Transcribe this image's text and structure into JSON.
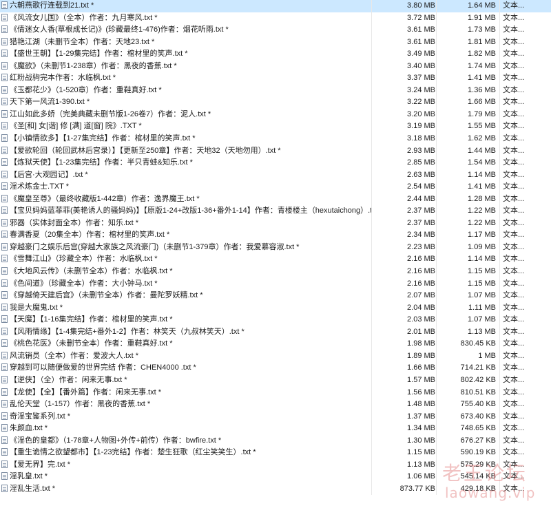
{
  "colors": {
    "selected_row": "#cce8ff",
    "watermark": "#e07878"
  },
  "icon": "text-file-icon",
  "rows": [
    {
      "name": "六朝燕歌行连载到21.txt *",
      "size": "3.80 MB",
      "compressed": "1.64 MB",
      "type": "文本...",
      "selected": true
    },
    {
      "name": "《风流女儿国》（全本）作者：九月寒风.txt *",
      "size": "3.72 MB",
      "compressed": "1.91 MB",
      "type": "文本..."
    },
    {
      "name": "《倩迷女人香(草根成长记)》(珍藏最终1-476)作者：烟花听雨.txt *",
      "size": "3.61 MB",
      "compressed": "1.73 MB",
      "type": "文本..."
    },
    {
      "name": "猎艳江湖（未删节全本）作者：天地23.txt *",
      "size": "3.61 MB",
      "compressed": "1.81 MB",
      "type": "文本..."
    },
    {
      "name": "【盛世王朝】【1-29集完结】作者：棺材里的笑声.txt *",
      "size": "3.49 MB",
      "compressed": "1.82 MB",
      "type": "文本..."
    },
    {
      "name": "《魔欲》（未删节1-238章）作者：黑夜的香蕉.txt *",
      "size": "3.40 MB",
      "compressed": "1.74 MB",
      "type": "文本..."
    },
    {
      "name": "红粉战驹完本作者：水临枫.txt *",
      "size": "3.37 MB",
      "compressed": "1.41 MB",
      "type": "文本..."
    },
    {
      "name": "《玉都花少》（1-520章）作者：重鞋真好.txt *",
      "size": "3.24 MB",
      "compressed": "1.36 MB",
      "type": "文本..."
    },
    {
      "name": "天下第一风流1-390.txt *",
      "size": "3.22 MB",
      "compressed": "1.66 MB",
      "type": "文本..."
    },
    {
      "name": "江山如此多娇（完美典藏未删节版1-26卷7）作者：泥人.txt *",
      "size": "3.20 MB",
      "compressed": "1.79 MB",
      "type": "文本..."
    },
    {
      "name": "《圣[和] 女[谐] 修 [满] 道[窗] 院》.TXT *",
      "size": "3.19 MB",
      "compressed": "1.55 MB",
      "type": "文本..."
    },
    {
      "name": "【小镇情欲多】【1-27集完结】作者：棺材里的笑声.txt *",
      "size": "3.18 MB",
      "compressed": "1.62 MB",
      "type": "文本..."
    },
    {
      "name": "【爱欲轮回（轮回武林后宫录）】【更新至250章】作者：天地32（天地勿用）.txt *",
      "size": "2.93 MB",
      "compressed": "1.44 MB",
      "type": "文本..."
    },
    {
      "name": "【炼狱天使】【1-23集完结】作者：半只青蛙&知乐.txt *",
      "size": "2.85 MB",
      "compressed": "1.54 MB",
      "type": "文本..."
    },
    {
      "name": "【后宫·大观园记】.txt *",
      "size": "2.63 MB",
      "compressed": "1.14 MB",
      "type": "文本..."
    },
    {
      "name": "淫术炼金士.TXT *",
      "size": "2.54 MB",
      "compressed": "1.41 MB",
      "type": "文本..."
    },
    {
      "name": "《魔皇至尊》（最终收藏版1-442章）作者：逸界魔王.txt *",
      "size": "2.44 MB",
      "compressed": "1.28 MB",
      "type": "文本..."
    },
    {
      "name": "【宝贝妈妈蓝菲菲(美艳诱人的骚妈妈)】【原版1-24+改版1-36+番外1-14】作者：青楼楼主（hexutaichong）.txt *",
      "size": "2.37 MB",
      "compressed": "1.22 MB",
      "type": "文本..."
    },
    {
      "name": "邪器（实体封面全本）作者：知乐.txt *",
      "size": "2.37 MB",
      "compressed": "1.22 MB",
      "type": "文本..."
    },
    {
      "name": "春满香夏（20集全本）作者：棺材里的笑声.txt *",
      "size": "2.34 MB",
      "compressed": "1.17 MB",
      "type": "文本..."
    },
    {
      "name": "穿越豪门之娱乐后宫(穿越大家族之风流豪门)（未删节1-379章）作者：我爱慕容淑.txt *",
      "size": "2.23 MB",
      "compressed": "1.09 MB",
      "type": "文本..."
    },
    {
      "name": "《雪舞江山》（珍藏全本）作者：水临枫.txt *",
      "size": "2.16 MB",
      "compressed": "1.14 MB",
      "type": "文本..."
    },
    {
      "name": "《大地风云传》（未删节全本）作者：水临枫.txt *",
      "size": "2.16 MB",
      "compressed": "1.15 MB",
      "type": "文本..."
    },
    {
      "name": "《色间道》（珍藏全本）作者：大小钟马.txt *",
      "size": "2.16 MB",
      "compressed": "1.15 MB",
      "type": "文本..."
    },
    {
      "name": "《穿越倚天建后宫》（未删节全本）作者：曼陀罗妖精.txt *",
      "size": "2.07 MB",
      "compressed": "1.07 MB",
      "type": "文本..."
    },
    {
      "name": "我是大魔鬼.txt *",
      "size": "2.04 MB",
      "compressed": "1.11 MB",
      "type": "文本..."
    },
    {
      "name": "【天魔】【1-16集完结】作者：棺材里的笑声.txt *",
      "size": "2.03 MB",
      "compressed": "1.07 MB",
      "type": "文本..."
    },
    {
      "name": "【风雨情缘】【1-4集完结+番外1-2】作者：林笑天（九叔林笑天）.txt *",
      "size": "2.01 MB",
      "compressed": "1.13 MB",
      "type": "文本..."
    },
    {
      "name": "《桃色花医》（未删节全本）作者：重鞋真好.txt *",
      "size": "1.98 MB",
      "compressed": "830.45 KB",
      "type": "文本..."
    },
    {
      "name": "风流销员（全本）作者：爱波大人.txt *",
      "size": "1.89 MB",
      "compressed": "1 MB",
      "type": "文本..."
    },
    {
      "name": "穿越到可以随便做爱的世界完结 作者：CHEN4000 .txt *",
      "size": "1.66 MB",
      "compressed": "714.21 KB",
      "type": "文本..."
    },
    {
      "name": "【逆侠】（全）作者：闲来无事.txt *",
      "size": "1.57 MB",
      "compressed": "802.42 KB",
      "type": "文本..."
    },
    {
      "name": "【龙使】【全】【番外篇】作者：闲来无事.txt *",
      "size": "1.56 MB",
      "compressed": "810.51 KB",
      "type": "文本..."
    },
    {
      "name": "乱伦天堂（1-157）作者：黑夜的香蕉.txt *",
      "size": "1.48 MB",
      "compressed": "755.40 KB",
      "type": "文本..."
    },
    {
      "name": "奇淫宝鉴系列.txt *",
      "size": "1.37 MB",
      "compressed": "673.40 KB",
      "type": "文本..."
    },
    {
      "name": "朱颜血.txt *",
      "size": "1.34 MB",
      "compressed": "748.65 KB",
      "type": "文本..."
    },
    {
      "name": "《淫色的皇都》（1-78章+人物图+外传+前传）作者：bwfire.txt *",
      "size": "1.30 MB",
      "compressed": "676.27 KB",
      "type": "文本..."
    },
    {
      "name": "【重生诡情之欲望都市】【1-23完结】作者：楚生狂歌（红尘笑笑生）.txt *",
      "size": "1.15 MB",
      "compressed": "590.19 KB",
      "type": "文本..."
    },
    {
      "name": "【爱无界】完.txt *",
      "size": "1.13 MB",
      "compressed": "575.29 KB",
      "type": "文本..."
    },
    {
      "name": "淫乳皇.txt *",
      "size": "1.06 MB",
      "compressed": "545.14 KB",
      "type": "文本..."
    },
    {
      "name": "淫乱生活.txt *",
      "size": "873.77 KB",
      "compressed": "429.18 KB",
      "type": "文本..."
    }
  ],
  "watermark": {
    "line1": "老王论坛",
    "line2": "laowang.vip"
  }
}
